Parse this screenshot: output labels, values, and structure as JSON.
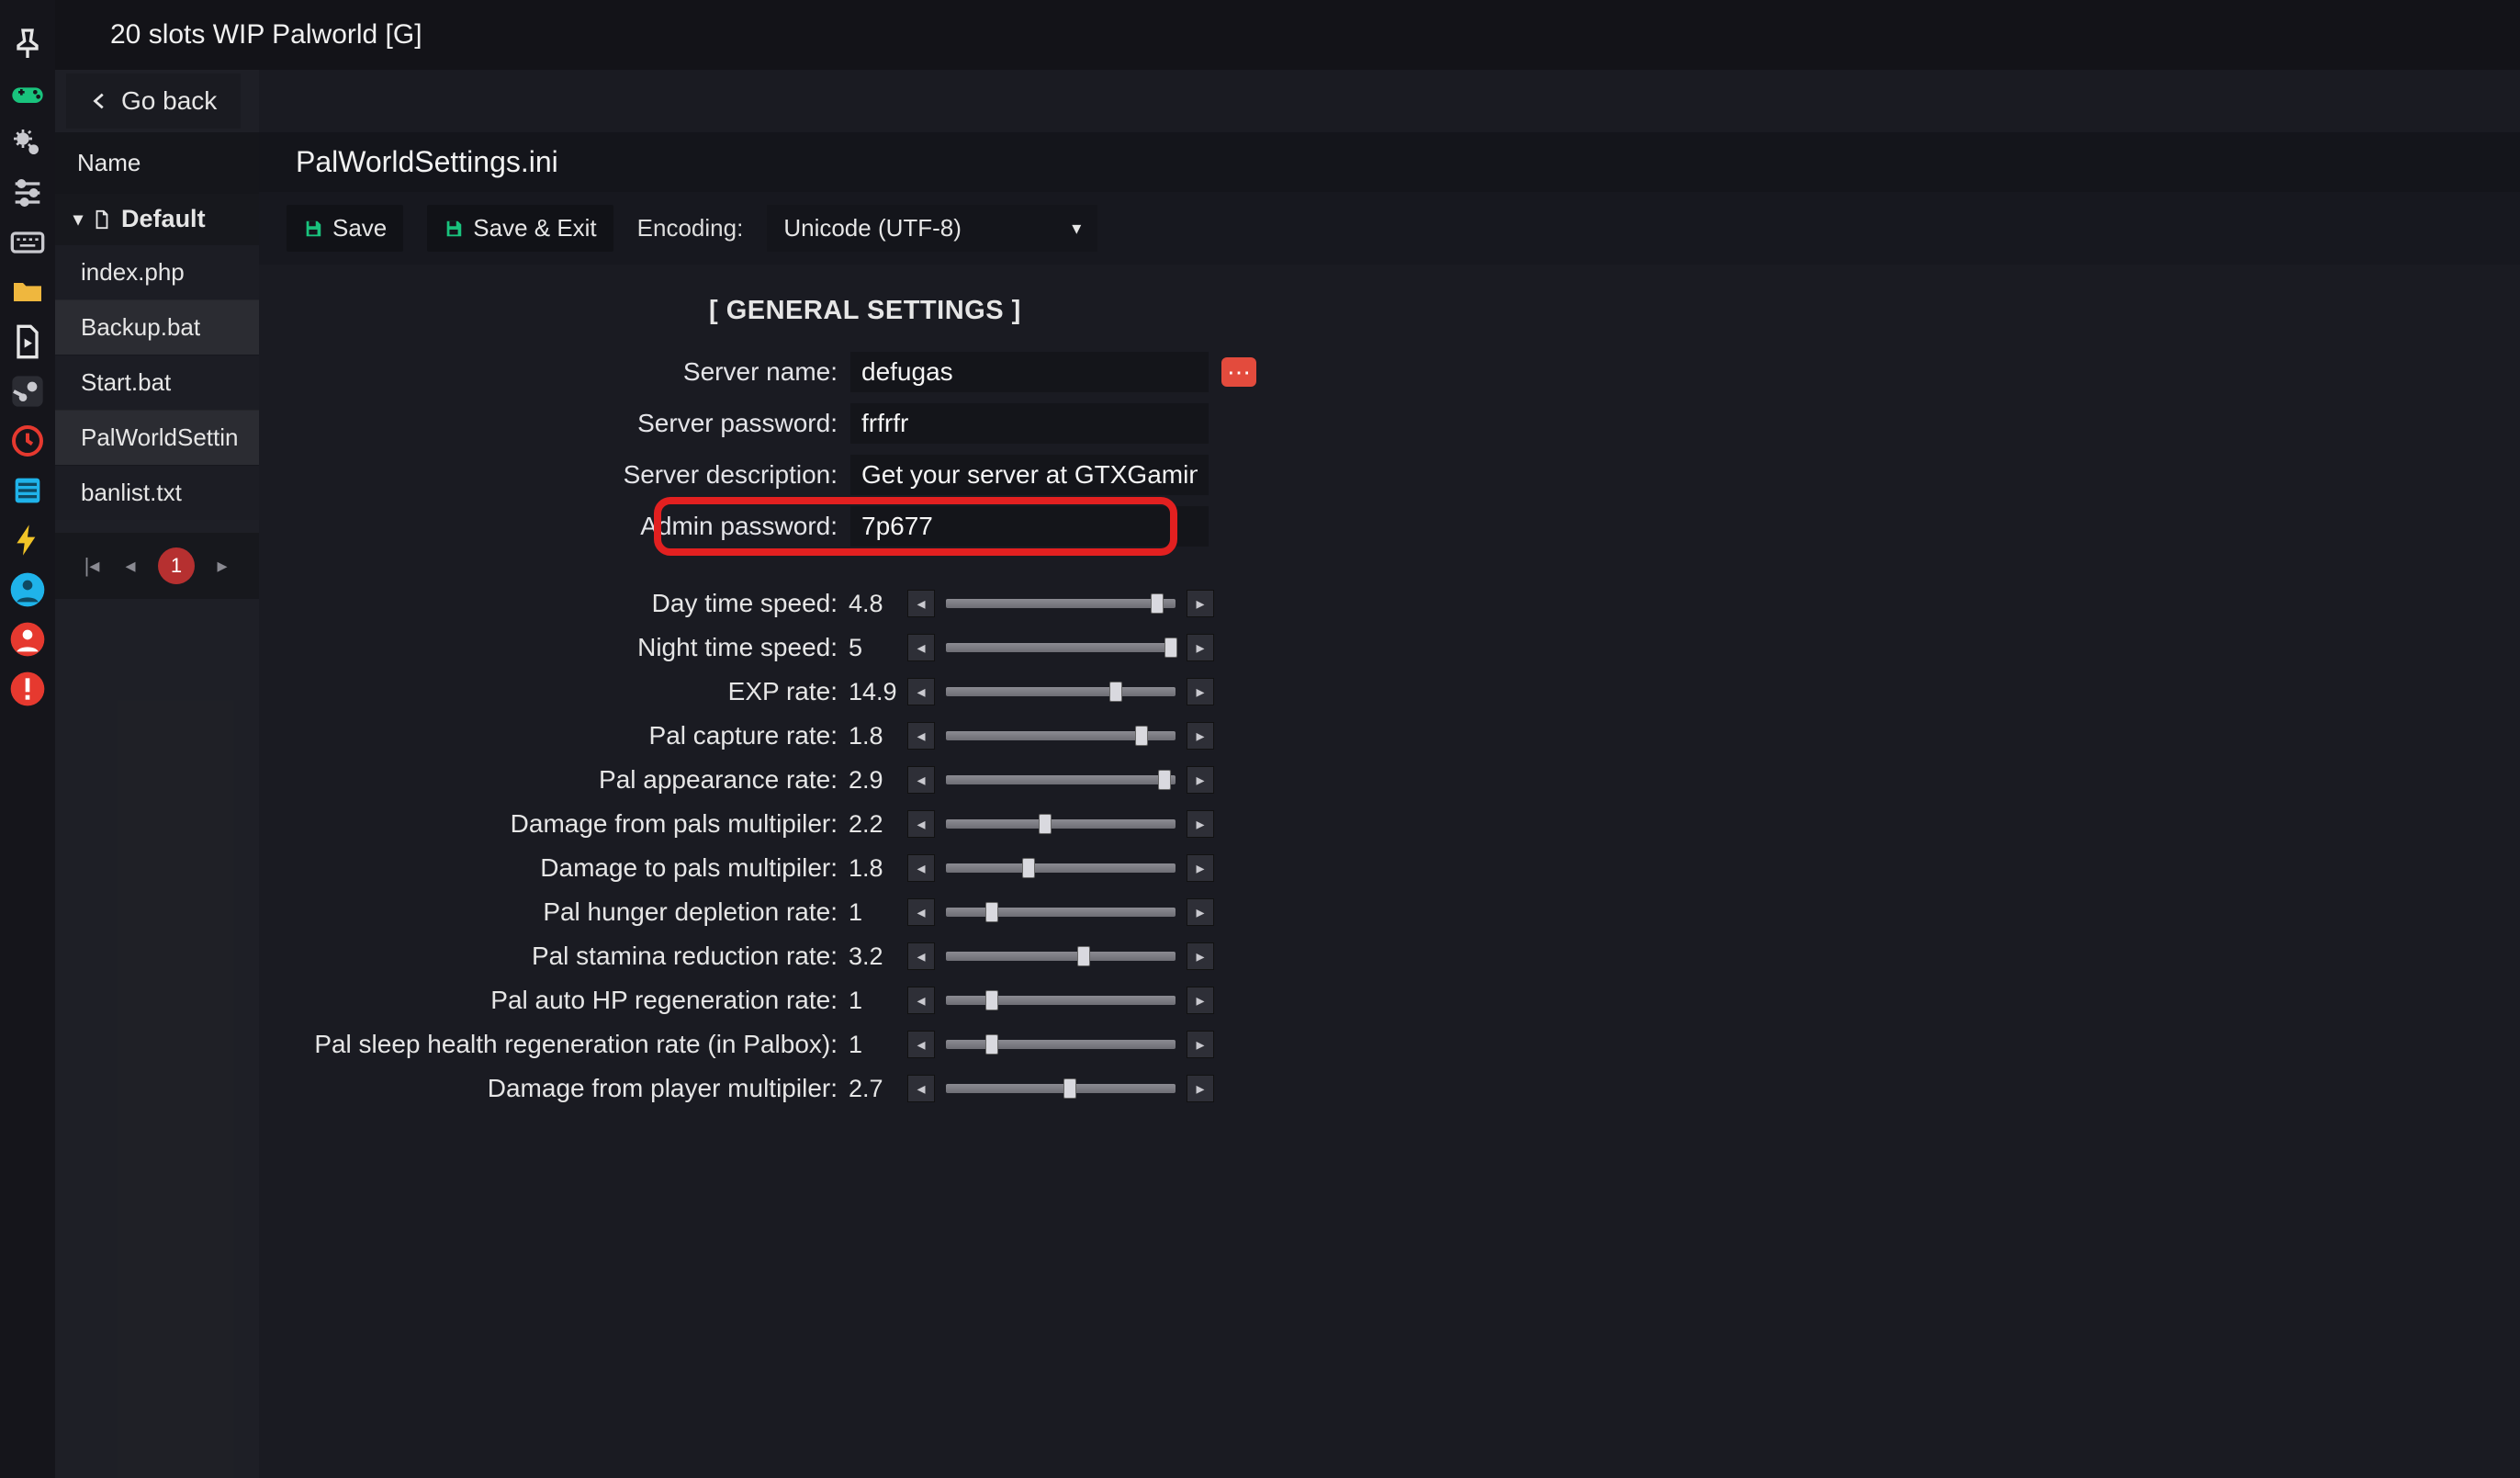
{
  "title": "20 slots WIP Palworld [G]",
  "go_back": "Go back",
  "rail": {
    "items": [
      {
        "id": "pin-icon",
        "color": "#e6e6e6"
      },
      {
        "id": "gamepad-icon",
        "color": "#19c37d"
      },
      {
        "id": "gears-icon",
        "color": "#c9c9cf"
      },
      {
        "id": "sliders-icon",
        "color": "#c9c9cf"
      },
      {
        "id": "keyboard-icon",
        "color": "#c9c9cf"
      },
      {
        "id": "folder-icon",
        "color": "#efb73e"
      },
      {
        "id": "file-play-icon",
        "color": "#e6e6e6"
      },
      {
        "id": "steam-icon",
        "color": "#c9c9cf"
      },
      {
        "id": "clock-icon",
        "color": "#e6392f"
      },
      {
        "id": "drive-icon",
        "color": "#1fb3ea"
      },
      {
        "id": "bolt-icon",
        "color": "#f2c427"
      },
      {
        "id": "user-circle-icon",
        "color": "#1fb3ea"
      },
      {
        "id": "user-alert-icon",
        "color": "#e6392f"
      },
      {
        "id": "error-icon",
        "color": "#e6392f"
      }
    ]
  },
  "filetree": {
    "header": "Name",
    "folder": "Default",
    "items": [
      {
        "label": "index.php",
        "state": "dim"
      },
      {
        "label": "Backup.bat",
        "state": "active"
      },
      {
        "label": "Start.bat",
        "state": "dim"
      },
      {
        "label": "PalWorldSettin",
        "state": "active"
      },
      {
        "label": "banlist.txt",
        "state": "dim"
      }
    ],
    "pager": {
      "current": "1"
    }
  },
  "editor": {
    "title": "PalWorldSettings.ini",
    "toolbar": {
      "save": "Save",
      "save_exit": "Save & Exit",
      "encoding_label": "Encoding:",
      "encoding_value": "Unicode (UTF-8)"
    },
    "section": "[ GENERAL SETTINGS ]",
    "text_fields": [
      {
        "label": "Server name:",
        "value": "defugas",
        "extra": true
      },
      {
        "label": "Server password:",
        "value": "frfrfr"
      },
      {
        "label": "Server description:",
        "value": "Get your server at GTXGaming.c"
      },
      {
        "label": "Admin password:",
        "value": "7p677",
        "highlight": true
      }
    ],
    "sliders": [
      {
        "label": "Day time speed:",
        "value": "4.8",
        "pos": 0.92
      },
      {
        "label": "Night time speed:",
        "value": "5",
        "pos": 0.98
      },
      {
        "label": "EXP rate:",
        "value": "14.9",
        "pos": 0.74
      },
      {
        "label": "Pal capture rate:",
        "value": "1.8",
        "pos": 0.85
      },
      {
        "label": "Pal appearance rate:",
        "value": "2.9",
        "pos": 0.95
      },
      {
        "label": "Damage from pals multipiler:",
        "value": "2.2",
        "pos": 0.43
      },
      {
        "label": "Damage to pals multipiler:",
        "value": "1.8",
        "pos": 0.36
      },
      {
        "label": "Pal hunger depletion rate:",
        "value": "1",
        "pos": 0.2
      },
      {
        "label": "Pal stamina reduction rate:",
        "value": "3.2",
        "pos": 0.6
      },
      {
        "label": "Pal auto HP regeneration rate:",
        "value": "1",
        "pos": 0.2
      },
      {
        "label": "Pal sleep health regeneration rate (in Palbox):",
        "value": "1",
        "pos": 0.2
      },
      {
        "label": "Damage from player multipiler:",
        "value": "2.7",
        "pos": 0.54
      }
    ]
  }
}
